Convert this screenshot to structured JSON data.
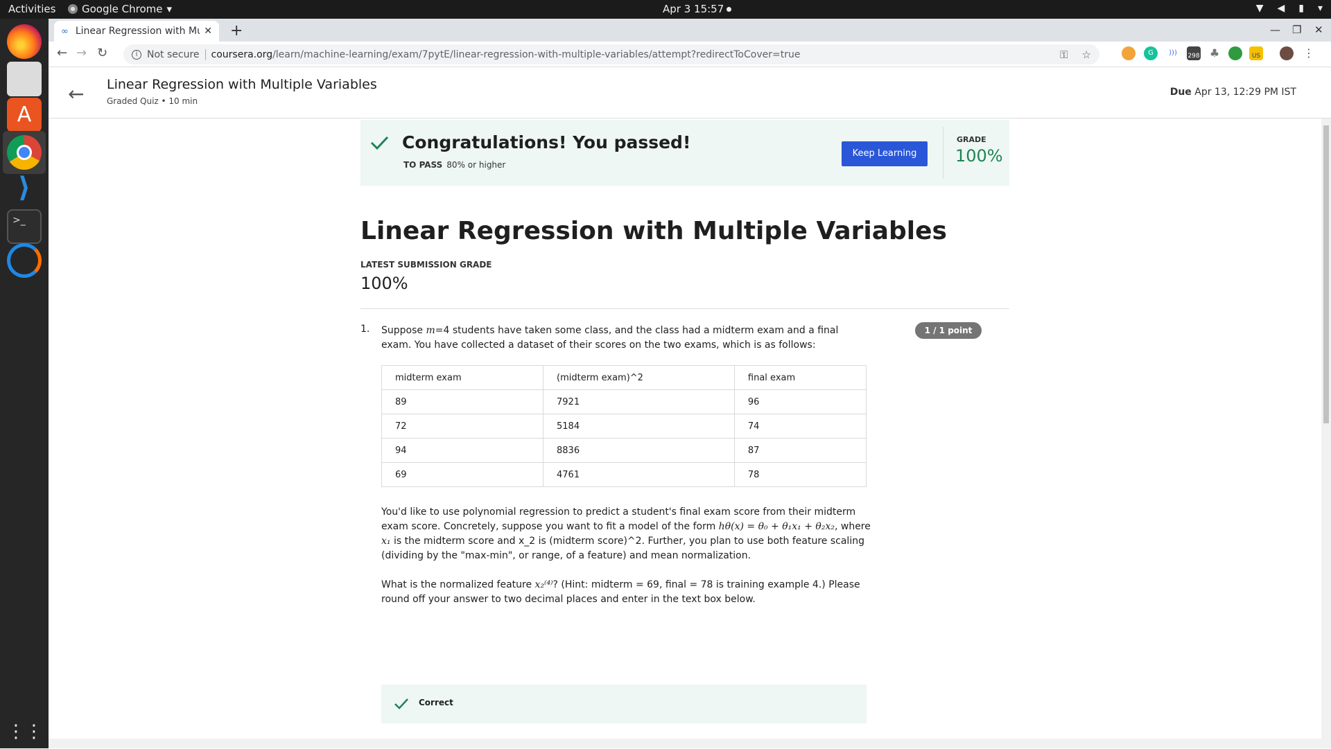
{
  "topbar": {
    "activities": "Activities",
    "app_name": "Google Chrome",
    "clock": "Apr 3  15:57"
  },
  "browser": {
    "tab_title": "Linear Regression with Multiple Variables",
    "security_label": "Not secure",
    "url_host": "coursera.org",
    "url_path": "/learn/machine-learning/exam/7pytE/linear-regression-with-multiple-variables/attempt?redirectToCover=true",
    "ext_badge_count": "298",
    "ext_badge_us": "US"
  },
  "header": {
    "title": "Linear Regression with Multiple Variables",
    "subtitle": "Graded Quiz • 10 min",
    "due_label": "Due",
    "due_value": "Apr 13, 12:29 PM IST"
  },
  "banner": {
    "message": "Congratulations! You passed!",
    "to_pass_label": "TO PASS",
    "to_pass_value": "80% or higher",
    "button_label": "Keep Learning",
    "grade_label": "GRADE",
    "grade_value": "100%"
  },
  "quiz": {
    "title": "Linear Regression with Multiple Variables",
    "latest_label": "LATEST SUBMISSION GRADE",
    "latest_value": "100%"
  },
  "question": {
    "number": "1.",
    "points": "1 / 1 point",
    "intro_before": "Suppose ",
    "intro_var": "m",
    "intro_after": "=4 students have taken some class, and the class had a midterm exam and a final exam. You have collected a dataset of their scores on the two exams, which is as follows:",
    "table": {
      "headers": [
        "midterm exam",
        "(midterm exam)^2",
        "final exam"
      ],
      "rows": [
        [
          "89",
          "7921",
          "96"
        ],
        [
          "72",
          "5184",
          "74"
        ],
        [
          "94",
          "8836",
          "87"
        ],
        [
          "69",
          "4761",
          "78"
        ]
      ]
    },
    "para1_a": "You'd like to use polynomial regression to predict a student's final exam score from their midterm exam score. Concretely, suppose you want to fit a model of the form ",
    "para1_math": "hθ(x) = θ₀ + θ₁x₁ + θ₂x₂",
    "para1_b": ", where ",
    "para1_x1": "x₁",
    "para1_c": " is the midterm score and x_2 is (midterm score)^2. Further, you plan to use both feature scaling (dividing by the \"max-min\", or range, of a feature) and mean normalization.",
    "para2_a": "What is the normalized feature ",
    "para2_math": "x₂⁽⁴⁾",
    "para2_b": "? (Hint: midterm = 69, final = 78 is training example 4.) Please round off your answer to two decimal places and enter in the text box below.",
    "feedback": "Correct"
  }
}
